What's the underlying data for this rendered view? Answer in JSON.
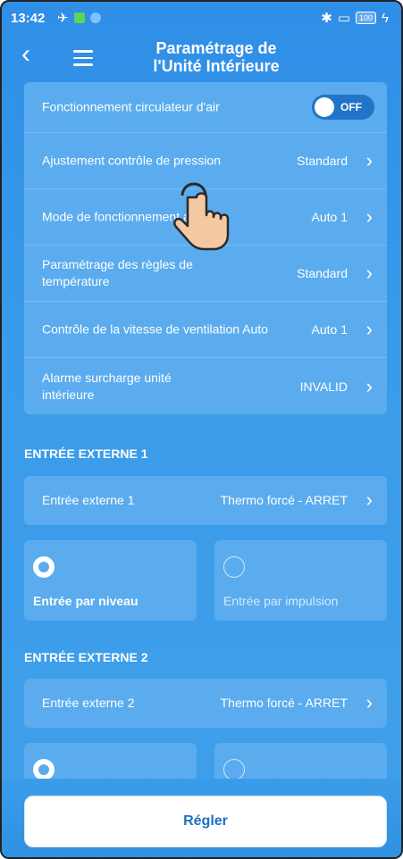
{
  "status": {
    "time": "13:42",
    "battery": "100"
  },
  "header": {
    "title_line1": "Paramétrage de",
    "title_line2": "l'Unité Intérieure"
  },
  "settings": [
    {
      "label": "Fonctionnement circulateur d'air",
      "toggle": "OFF"
    },
    {
      "label": "Ajustement contrôle de pression",
      "value": "Standard"
    },
    {
      "label": "Mode de fonctionnement auto",
      "value": "Auto 1"
    },
    {
      "label": "Paramétrage des règles de température",
      "value": "Standard"
    },
    {
      "label": "Contrôle de la vitesse de ventilation Auto",
      "value": "Auto 1"
    },
    {
      "label": "Alarme surcharge unité intérieure",
      "value": "INVALID"
    }
  ],
  "ext1": {
    "title": "ENTRÉE EXTERNE 1",
    "label": "Entrée externe 1",
    "value": "Thermo forcé - ARRET",
    "opt_level": "Entrée par niveau",
    "opt_pulse": "Entrée par impulsion"
  },
  "ext2": {
    "title": "ENTRÉE EXTERNE 2",
    "label": "Entrée externe 2",
    "value": "Thermo forcé - ARRET"
  },
  "button": {
    "label": "Régler"
  }
}
